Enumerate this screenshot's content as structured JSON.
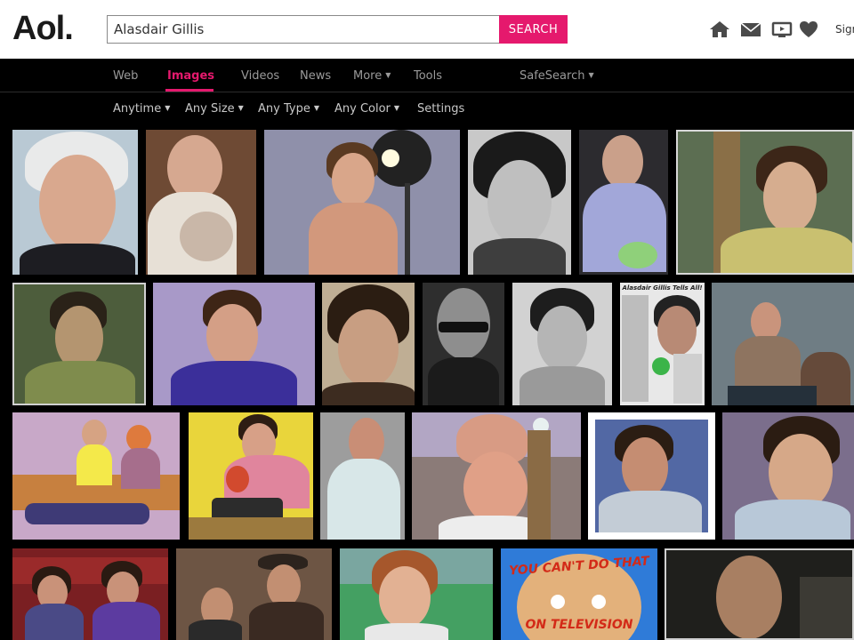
{
  "header": {
    "logo": "Aol.",
    "search_value": "Alasdair Gillis",
    "search_button": "SEARCH",
    "icons": [
      "home-icon",
      "mail-icon",
      "tv-icon",
      "heart-icon"
    ],
    "sign_in": "Sign"
  },
  "nav": {
    "tabs": [
      {
        "label": "Web"
      },
      {
        "label": "Images",
        "active": true
      },
      {
        "label": "Videos"
      },
      {
        "label": "News"
      },
      {
        "label": "More"
      },
      {
        "label": "Tools"
      },
      {
        "label": "SafeSearch"
      }
    ]
  },
  "filters": [
    {
      "label": "Anytime"
    },
    {
      "label": "Any Size"
    },
    {
      "label": "Any Type"
    },
    {
      "label": "Any Color"
    },
    {
      "label": "Settings"
    }
  ],
  "colors": {
    "accent": "#e5196d",
    "background": "#000000"
  },
  "thumbnails": [
    {
      "name": "grey-haired-man-closeup"
    },
    {
      "name": "bald-man-holding-baby"
    },
    {
      "name": "shirtless-boy-with-stage-light"
    },
    {
      "name": "bw-boy-portrait"
    },
    {
      "name": "smiling-bald-man-at-dinner"
    },
    {
      "name": "boy-outdoors-yellow-shirt"
    },
    {
      "name": "boy-green-tint"
    },
    {
      "name": "boy-blue-sweater"
    },
    {
      "name": "sepia-boy-portrait"
    },
    {
      "name": "man-with-sunglasses"
    },
    {
      "name": "bw-boy-smiling"
    },
    {
      "name": "magazine-clipping"
    },
    {
      "name": "man-seated-on-couch"
    },
    {
      "name": "kids-tv-set-scene"
    },
    {
      "name": "boy-with-typewriter"
    },
    {
      "name": "man-white-shirt"
    },
    {
      "name": "man-with-chicken-hat"
    },
    {
      "name": "boy-framed-portrait"
    },
    {
      "name": "boy-tv-studio"
    },
    {
      "name": "boys-in-theatre-seats"
    },
    {
      "name": "boy-and-man-with-hat"
    },
    {
      "name": "red-haired-boy"
    },
    {
      "name": "you-cant-do-that-on-television-poster"
    },
    {
      "name": "bald-man-dark-scene"
    }
  ],
  "poster_text": {
    "top": "YOU CAN'T DO THAT",
    "bottom": "ON TELEVISION"
  },
  "clipping_text": "Alasdair Gillis Tells All!"
}
